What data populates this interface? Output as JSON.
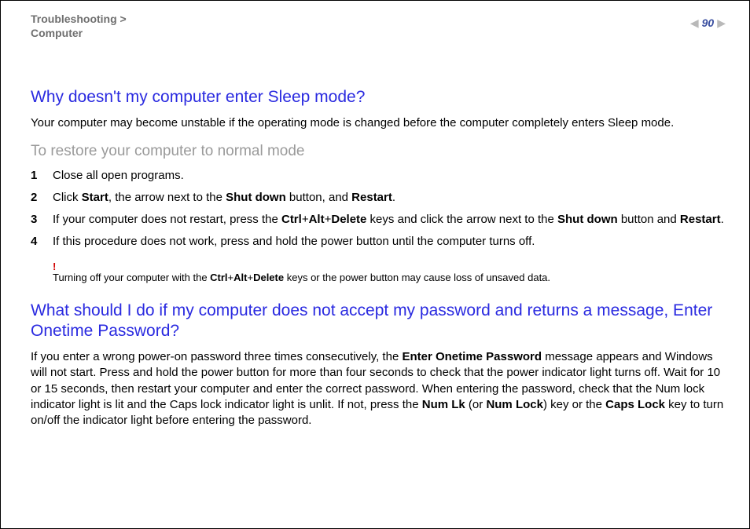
{
  "header": {
    "breadcrumb_line1": "Troubleshooting >",
    "breadcrumb_line2": "Computer",
    "page_number": "90"
  },
  "section1": {
    "title": "Why doesn't my computer enter Sleep mode?",
    "intro": "Your computer may become unstable if the operating mode is changed before the computer completely enters Sleep mode.",
    "subtitle": "To restore your computer to normal mode",
    "steps": {
      "n1": "1",
      "s1": "Close all open programs.",
      "n2": "2",
      "s2_a": "Click ",
      "s2_b": "Start",
      "s2_c": ", the arrow next to the ",
      "s2_d": "Shut down",
      "s2_e": " button, and ",
      "s2_f": "Restart",
      "s2_g": ".",
      "n3": "3",
      "s3_a": "If your computer does not restart, press the ",
      "s3_b": "Ctrl",
      "s3_c": "+",
      "s3_d": "Alt",
      "s3_e": "+",
      "s3_f": "Delete",
      "s3_g": " keys and click the arrow next to the ",
      "s3_h": "Shut down",
      "s3_i": " button and ",
      "s3_j": "Restart",
      "s3_k": ".",
      "n4": "4",
      "s4": "If this procedure does not work, press and hold the power button until the computer turns off."
    },
    "warning": {
      "bang": "!",
      "a": "Turning off your computer with the ",
      "b": "Ctrl",
      "c": "+",
      "d": "Alt",
      "e": "+",
      "f": "Delete",
      "g": " keys or the power button may cause loss of unsaved data."
    }
  },
  "section2": {
    "title": "What should I do if my computer does not accept my password and returns a message, Enter Onetime Password?",
    "p_a": "If you enter a wrong power-on password three times consecutively, the ",
    "p_b": "Enter Onetime Password",
    "p_c": " message appears and Windows will not start. Press and hold the power button for more than four seconds to check that the power indicator light turns off. Wait for 10 or 15 seconds, then restart your computer and enter the correct password. When entering the password, check that the Num lock indicator light is lit and the Caps lock indicator light is unlit. If not, press the ",
    "p_d": "Num Lk",
    "p_e": " (or ",
    "p_f": "Num Lock",
    "p_g": ") key or the ",
    "p_h": "Caps Lock",
    "p_i": " key to turn on/off the indicator light before entering the password."
  }
}
